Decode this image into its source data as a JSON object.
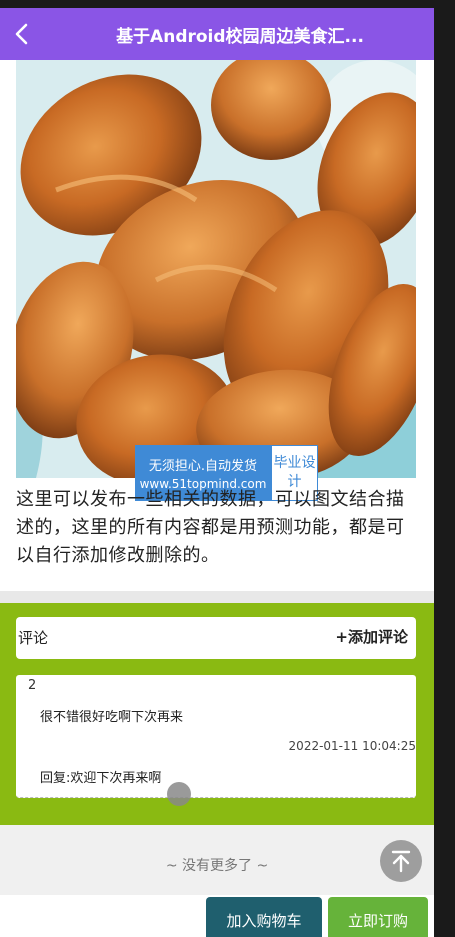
{
  "header": {
    "title": "基于Android校园周边美食汇...",
    "back_icon": "chevron-left-icon"
  },
  "watermark": {
    "line1": "无须担心.自动发货",
    "line2": "www.51topmind.com",
    "right": "毕业设计"
  },
  "description": "这里可以发布一些相关的数据，可以图文结合描述的，这里的所有内容都是用预测功能，都是可以自行添加修改删除的。",
  "comments": {
    "label": "评论",
    "add_label": "+添加评论",
    "items": [
      {
        "index": "2",
        "text": "很不错很好吃啊下次再来",
        "time": "2022-01-11 10:04:25",
        "reply": "回复:欢迎下次再来啊"
      }
    ]
  },
  "list_end_text": "~ 没有更多了 ~",
  "footer": {
    "add_to_cart": "加入购物车",
    "buy_now": "立即订购"
  },
  "colors": {
    "header_bg": "#8a55e6",
    "comment_bg": "#8aba12",
    "cart_button": "#1f5f6e",
    "buy_button": "#66b33a"
  }
}
